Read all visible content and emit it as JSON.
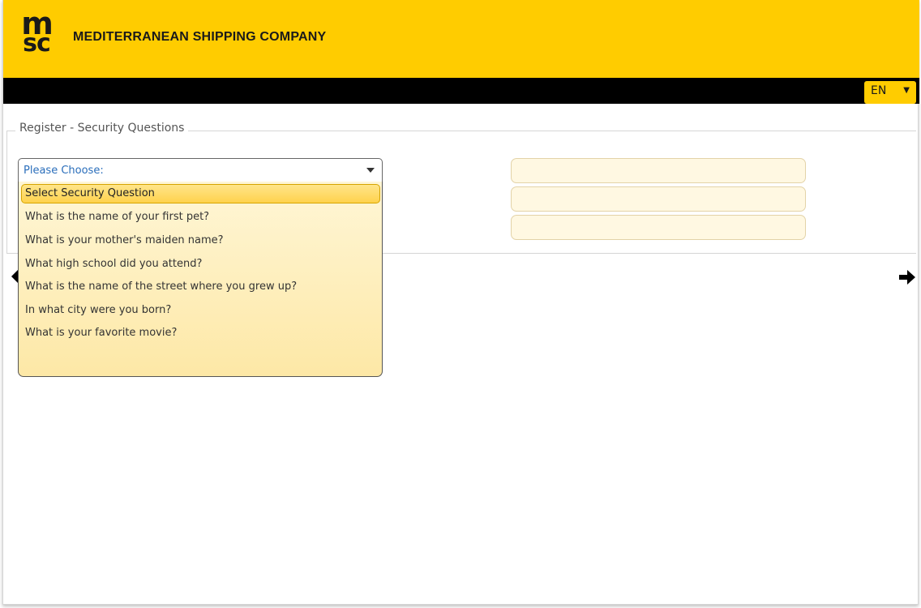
{
  "header": {
    "logo_top": "m",
    "logo_bottom": "sc",
    "company_name": "MEDITERRANEAN SHIPPING COMPANY"
  },
  "topbar": {
    "language": "EN",
    "language_arrow": "▼"
  },
  "form": {
    "legend": "Register - Security Questions",
    "question_1": {
      "placeholder": "Please Choose:",
      "options": [
        "Select Security Question",
        "What is the name of your first pet?",
        "What is your mother's maiden name?",
        "What high school did you attend?",
        "What is the name of the street where you grew up?",
        "In what city were you born?",
        "What is your favorite movie?"
      ],
      "highlighted_option": "Select Security Question"
    },
    "answers": [
      "",
      "",
      ""
    ]
  },
  "navigation": {
    "prev_icon": "arrow-left-icon",
    "next_icon": "arrow-right-icon"
  },
  "colors": {
    "brand_yellow": "#ffcc00",
    "topbar": "#000000",
    "link_blue": "#2a6ebb",
    "answer_bg": "#fff8e2"
  }
}
